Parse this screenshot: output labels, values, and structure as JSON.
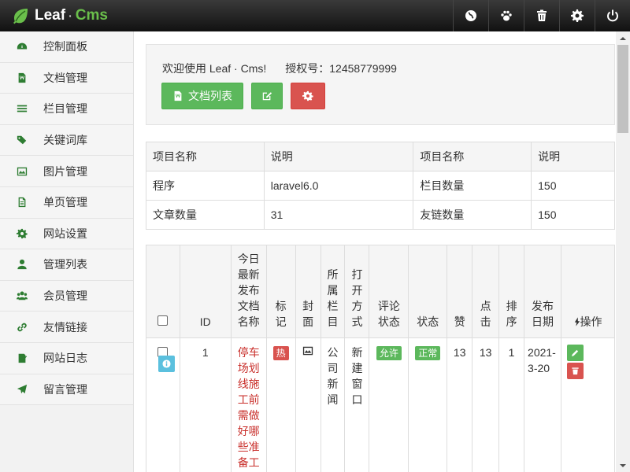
{
  "brand": {
    "name_part1": "Leaf",
    "dot": "·",
    "name_part2": "Cms"
  },
  "top_actions": [
    "globe-icon",
    "paw-icon",
    "trash-icon",
    "gear-icon",
    "power-icon"
  ],
  "sidebar": {
    "items": [
      {
        "label": "控制面板",
        "icon": "dashboard-icon"
      },
      {
        "label": "文档管理",
        "icon": "document-icon"
      },
      {
        "label": "栏目管理",
        "icon": "list-icon"
      },
      {
        "label": "关键词库",
        "icon": "tags-icon"
      },
      {
        "label": "图片管理",
        "icon": "image-icon"
      },
      {
        "label": "单页管理",
        "icon": "page-icon"
      },
      {
        "label": "网站设置",
        "icon": "gear-icon"
      },
      {
        "label": "管理列表",
        "icon": "user-icon"
      },
      {
        "label": "会员管理",
        "icon": "users-icon"
      },
      {
        "label": "友情链接",
        "icon": "link-icon"
      },
      {
        "label": "网站日志",
        "icon": "log-icon"
      },
      {
        "label": "留言管理",
        "icon": "send-icon"
      }
    ]
  },
  "welcome": {
    "greeting": "欢迎使用 Leaf · Cms!",
    "license_label": "授权号：12458779999",
    "doc_list_button": "文档列表"
  },
  "info_table": {
    "headers": [
      "项目名称",
      "说明",
      "项目名称",
      "说明"
    ],
    "rows": [
      [
        "程序",
        "laravel6.0",
        "栏目数量",
        "150"
      ],
      [
        "文章数量",
        "31",
        "友链数量",
        "150"
      ]
    ]
  },
  "list_table": {
    "headers": {
      "id": "ID",
      "title": "今日最新发布文档名称",
      "tag": "标记",
      "cover": "封面",
      "category": "所属栏目",
      "open_mode": "打开方式",
      "comment_status": "评论状态",
      "status": "状态",
      "likes": "赞",
      "clicks": "点击",
      "order": "排序",
      "date": "发布日期",
      "actions": "操作"
    },
    "rows": [
      {
        "id": "1",
        "title": "停车场划线施工前需做好哪些准备工",
        "tag": "热",
        "category": "公司新闻",
        "open_mode": "新建窗口",
        "comment_status": "允许",
        "status": "正常",
        "likes": "13",
        "clicks": "13",
        "order": "1",
        "date": "2021-3-20"
      }
    ]
  },
  "colors": {
    "accent_green": "#5cb85c",
    "danger_red": "#d9534f",
    "info_blue": "#5bc0de",
    "title_red": "#c9302c"
  }
}
